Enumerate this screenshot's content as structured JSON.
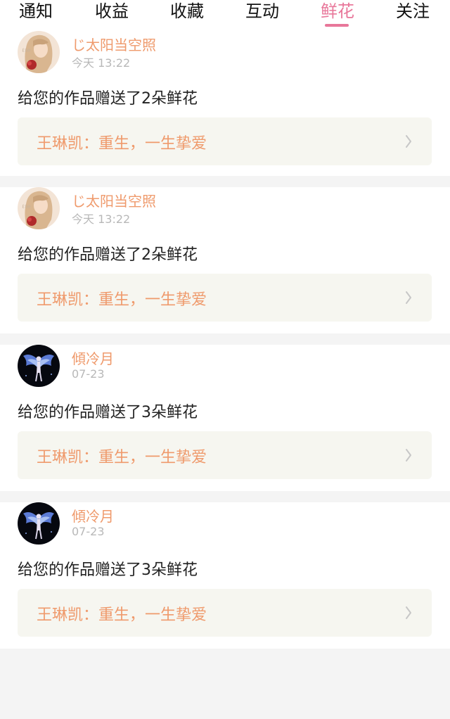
{
  "tabs": [
    {
      "label": "通知",
      "active": false
    },
    {
      "label": "收益",
      "active": false
    },
    {
      "label": "收藏",
      "active": false
    },
    {
      "label": "互动",
      "active": false
    },
    {
      "label": "鲜花",
      "active": true
    },
    {
      "label": "关注",
      "active": false
    }
  ],
  "colors": {
    "accent": "#e8779a",
    "username": "#ef9a6c",
    "link_bg": "#f6f6f0",
    "timestamp": "#b8b8b8"
  },
  "notifications": [
    {
      "avatar_icon": "girl-with-rose-avatar",
      "username": "じ太阳当空照",
      "time": "今天 13:22",
      "message": "给您的作品赠送了2朵鲜花",
      "work_title": "王琳凯：重生，一生挚爱"
    },
    {
      "avatar_icon": "girl-with-rose-avatar",
      "username": "じ太阳当空照",
      "time": "今天 13:22",
      "message": "给您的作品赠送了2朵鲜花",
      "work_title": "王琳凯：重生，一生挚爱"
    },
    {
      "avatar_icon": "winged-angel-avatar",
      "username": "傾冷月",
      "time": "07-23",
      "message": "给您的作品赠送了3朵鲜花",
      "work_title": "王琳凯：重生，一生挚爱"
    },
    {
      "avatar_icon": "winged-angel-avatar",
      "username": "傾冷月",
      "time": "07-23",
      "message": "给您的作品赠送了3朵鲜花",
      "work_title": "王琳凯：重生，一生挚爱"
    }
  ]
}
